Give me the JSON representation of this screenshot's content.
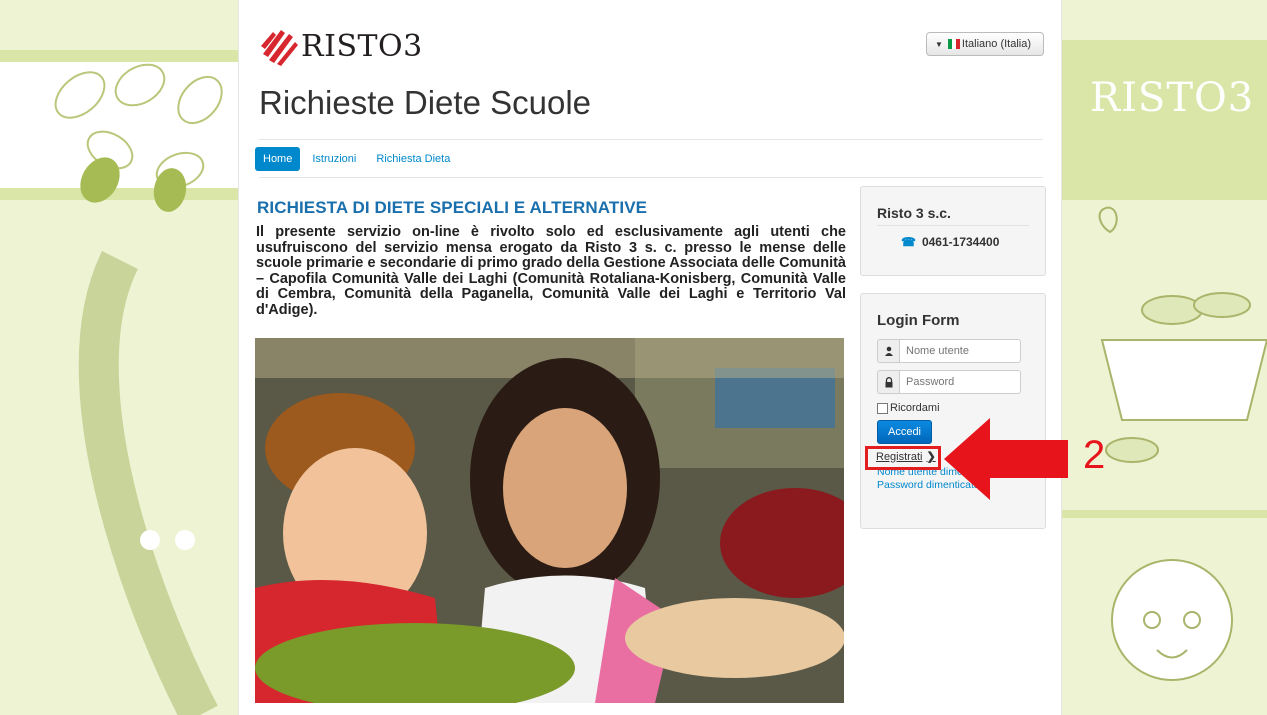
{
  "background": {
    "watermark": "RISTO3"
  },
  "header": {
    "logo_text": "RISTO3",
    "site_title": "Richieste Diete Scuole",
    "language_label": "Italiano (Italia)"
  },
  "nav": {
    "items": [
      {
        "label": "Home",
        "active": true
      },
      {
        "label": "Istruzioni",
        "active": false
      },
      {
        "label": "Richiesta Dieta",
        "active": false
      }
    ]
  },
  "article": {
    "title": "RICHIESTA DI DIETE SPECIALI E ALTERNATIVE",
    "body": "Il presente servizio on-line è rivolto solo ed esclusivamente agli utenti che usufruiscono del servizio mensa erogato da Risto 3 s. c. presso le mense delle scuole primarie e secondarie di primo grado della Gestione Associata delle Comunità – Capofila Comunità Valle dei Laghi (Comunità Rotaliana-Konisberg, Comunità Valle di Cembra, Comunità della Paganella, Comunità Valle dei Laghi e Territorio Val d'Adige)."
  },
  "contact": {
    "title": "Risto 3 s.c.",
    "phone": "0461-1734400"
  },
  "login": {
    "title": "Login Form",
    "username_placeholder": "Nome utente",
    "password_placeholder": "Password",
    "remember_label": "Ricordami",
    "submit_label": "Accedi",
    "register_label": "Registrati",
    "forgot_username": "Nome utente dimenticato?",
    "forgot_password": "Password dimenticata?"
  },
  "annotation": {
    "step": "2",
    "color": "#e8141b"
  },
  "colors": {
    "accent": "#0088cc",
    "title_blue": "#1a6fad"
  }
}
